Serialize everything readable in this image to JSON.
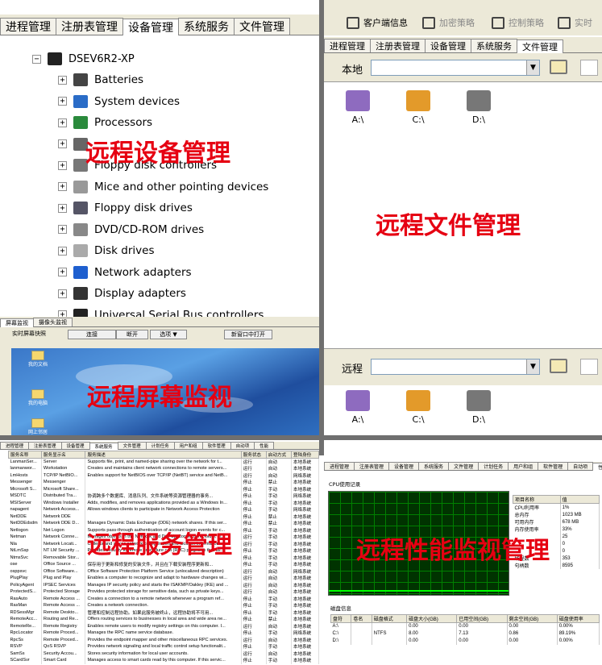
{
  "device_panel": {
    "tabs": [
      "进程管理",
      "注册表管理",
      "设备管理",
      "系统服务",
      "文件管理"
    ],
    "active_tab": 2,
    "computer_name": "DSEV6R2-XP",
    "devices": [
      "Batteries",
      "System devices",
      "Processors",
      "",
      "Floppy disk controllers",
      "Mice and other pointing devices",
      "Floppy disk drives",
      "DVD/CD-ROM drives",
      "Disk drives",
      "Network adapters",
      "Display adapters",
      "Universal Serial Bus controllers"
    ],
    "caption": "远程设备管理"
  },
  "file_panel": {
    "toolbar": [
      "客户端信息",
      "加密策略",
      "控制策略",
      "实时"
    ],
    "tabs": [
      "进程管理",
      "注册表管理",
      "设备管理",
      "系统服务",
      "文件管理"
    ],
    "active_tab": 4,
    "local_label": "本地",
    "remote_label": "远程",
    "drives": [
      "A:\\",
      "C:\\",
      "D:\\"
    ],
    "caption": "远程文件管理"
  },
  "screen_panel": {
    "tabs": [
      "屏幕监视",
      "摄像头监视"
    ],
    "buttons": [
      "实时屏幕快照",
      "连接",
      "断开",
      "选项 ▼",
      "新窗口中打开"
    ],
    "desktop_icons": [
      "我的文档",
      "我的电脑",
      "网上邻居"
    ],
    "caption": "远程屏幕监视"
  },
  "service_panel": {
    "tabs": [
      "进程管理",
      "注册表管理",
      "设备管理",
      "系统服务",
      "文件管理",
      "计划任务",
      "用户和组",
      "软件管理",
      "自动项",
      "性能"
    ],
    "active_tab": 3,
    "columns": [
      "服务名称",
      "服务显示名",
      "服务描述",
      "服务状态",
      "启动方式",
      "登陆身份"
    ],
    "rows": [
      [
        "LanmanSer...",
        "Server",
        "Supports file, print, and named-pipe sharing over the network for t...",
        "运行",
        "自动",
        "本地系统"
      ],
      [
        "lanmanwor...",
        "Workstation",
        "Creates and maintains client network connections to remote servers...",
        "运行",
        "自动",
        "本地系统"
      ],
      [
        "LmHosts",
        "TCP/IP NetBIO...",
        "Enables support for NetBIOS over TCP/IP (NetBT) service and NetB...",
        "运行",
        "自动",
        "网络系统"
      ],
      [
        "Messenger",
        "Messenger",
        "",
        "停止",
        "禁止",
        "本地系统"
      ],
      [
        "Microsoft S...",
        "Microsoft Share...",
        "",
        "停止",
        "手动",
        "本地系统"
      ],
      [
        "MSDTC",
        "Distributed Tra...",
        "协调跨多个数据库、消息队列、文件系统等资源管理器的事务...",
        "停止",
        "手动",
        "网络系统"
      ],
      [
        "MSIServer",
        "Windows Installer",
        "Adds, modifies, and removes applications provided as a Windows In...",
        "停止",
        "手动",
        "本地系统"
      ],
      [
        "napagent",
        "Network Access...",
        "Allows windows clients to participate in Network Access Protection",
        "停止",
        "手动",
        "网络系统"
      ],
      [
        "NetDDE",
        "Network DDE",
        "",
        "停止",
        "禁止",
        "本地系统"
      ],
      [
        "NetDDEdsdm",
        "Network DDE D...",
        "Manages Dynamic Data Exchange (DDE) network shares. If this ser...",
        "停止",
        "禁止",
        "本地系统"
      ],
      [
        "Netlogon",
        "Net Logon",
        "Supports pass-through authentication of account logon events for c...",
        "停止",
        "手动",
        "本地系统"
      ],
      [
        "Netman",
        "Network Conne...",
        "Manages objects in the Network and Dial-Up Connections folder, in...",
        "运行",
        "手动",
        "本地系统"
      ],
      [
        "Nla",
        "Network Locati...",
        "Collects and stores network configuration and location information...",
        "运行",
        "手动",
        "本地系统"
      ],
      [
        "NtLmSsp",
        "NT LM Security ...",
        "Provides security to remote procedure call (RPC) programs that us...",
        "停止",
        "手动",
        "本地系统"
      ],
      [
        "NtmsSvc",
        "Removable Stor...",
        "",
        "停止",
        "手动",
        "本地系统"
      ],
      [
        "ose",
        "Office Source ...",
        "保存用于更新和修复的安装文件，并且在下载安装程序更新和...",
        "停止",
        "手动",
        "本地系统"
      ],
      [
        "osppsvc",
        "Office Software...",
        "Office Software Protection Platform Service (unlocalized description)",
        "运行",
        "自动",
        "网络系统"
      ],
      [
        "PlugPlay",
        "Plug and Play",
        "Enables a computer to recognize and adapt to hardware changes wi...",
        "运行",
        "自动",
        "本地系统"
      ],
      [
        "PolicyAgent",
        "IPSEC Services",
        "Manages IP security policy and starts the ISAKMP/Oakley (IKE) and ...",
        "运行",
        "自动",
        "本地系统"
      ],
      [
        "ProtectedS...",
        "Protected Storage",
        "Provides protected storage for sensitive data, such as private keys...",
        "运行",
        "自动",
        "本地系统"
      ],
      [
        "RasAuto",
        "Remote Access ...",
        "Creates a connection to a remote network whenever a program ref...",
        "停止",
        "手动",
        "本地系统"
      ],
      [
        "RasMan",
        "Remote Access ...",
        "Creates a network connection.",
        "停止",
        "手动",
        "本地系统"
      ],
      [
        "RDSessMgr",
        "Remote Deskto...",
        "管理和控制远程协助。如果此服务被终止，远程协助将不可用...",
        "停止",
        "手动",
        "本地系统"
      ],
      [
        "RemoteAcc...",
        "Routing and Re...",
        "Offers routing services to businesses in local area and wide area ne...",
        "停止",
        "禁止",
        "本地系统"
      ],
      [
        "RemoteRe...",
        "Remote Registry",
        "Enables remote users to modify registry settings on this computer. I...",
        "运行",
        "自动",
        "本地系统"
      ],
      [
        "RpcLocator",
        "Remote Proced...",
        "Manages the RPC name service database.",
        "停止",
        "手动",
        "网络系统"
      ],
      [
        "RpcSs",
        "Remote Proced...",
        "Provides the endpoint mapper and other miscellaneous RPC services.",
        "运行",
        "自动",
        "本地系统"
      ],
      [
        "RSVP",
        "QoS RSVP",
        "Provides network signaling and local traffic control setup functionalit...",
        "停止",
        "手动",
        "本地系统"
      ],
      [
        "SamSs",
        "Security Accou...",
        "Stores security information for local user accounts.",
        "运行",
        "自动",
        "本地系统"
      ],
      [
        "SCardSvr",
        "Smart Card",
        "Manages access to smart cards read by this computer. If this servic...",
        "停止",
        "手动",
        "本地系统"
      ]
    ],
    "caption": "远程服务管理"
  },
  "perf_panel": {
    "tabs": [
      "进程管理",
      "注册表管理",
      "设备管理",
      "系统服务",
      "文件管理",
      "计划任务",
      "用户和组",
      "软件管理",
      "自动项",
      "性能"
    ],
    "active_tab": 9,
    "cpu_label": "CPU使用记录",
    "stats_header": [
      "项目名称",
      "值"
    ],
    "stats": [
      [
        "CPU利用率",
        "1%"
      ],
      [
        "总内存",
        "1023 MB"
      ],
      [
        "可用内存",
        "678 MB"
      ],
      [
        "内存使用率",
        "33%"
      ],
      [
        "",
        "25"
      ],
      [
        "",
        "0"
      ],
      [
        "",
        "0"
      ],
      [
        "线程数",
        "353"
      ],
      [
        "句柄数",
        "8595"
      ]
    ],
    "disk_label": "磁盘信息",
    "disk_columns": [
      "盘符",
      "卷名",
      "磁盘格式",
      "磁盘大小(GB)",
      "已用空间(GB)",
      "剩余空间(GB)",
      "磁盘使用率"
    ],
    "disks": [
      [
        "A:\\",
        "",
        "",
        "0.00",
        "0.00",
        "0.00",
        "0.00%"
      ],
      [
        "C:\\",
        "",
        "NTFS",
        "8.00",
        "7.13",
        "0.86",
        "89.19%"
      ],
      [
        "D:\\",
        "",
        "",
        "0.00",
        "0.00",
        "0.00",
        "0.00%"
      ]
    ],
    "caption": "远程性能监视管理"
  },
  "colors": {
    "caption": "#e60012",
    "divider": "#6f6f6f",
    "cpu_bg": "#003300",
    "cpu_grid": "#008000"
  }
}
